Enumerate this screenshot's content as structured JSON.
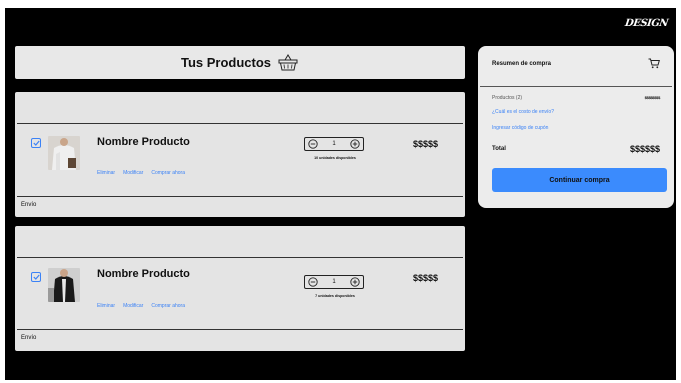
{
  "brand": {
    "logo_text": "DESIGN"
  },
  "header": {
    "title": "Tus Productos"
  },
  "products": [
    {
      "name": "Nombre Producto",
      "links": [
        "Eliminar",
        "Modificar",
        "Comprar ahora"
      ],
      "quantity": "1",
      "availability": "10 unidades disponibles",
      "price": "$$$$$",
      "shipping_label": "Envío",
      "checked": true
    },
    {
      "name": "Nombre Producto",
      "links": [
        "Eliminar",
        "Modificar",
        "Comprar ahora"
      ],
      "quantity": "1",
      "availability": "7 unidades disponibles",
      "price": "$$$$$",
      "shipping_label": "Envío",
      "checked": true
    }
  ],
  "summary": {
    "title": "Resumen de compra",
    "products_label": "Productos (2)",
    "products_value": "$$$$$$$$",
    "shipping_link": "¿Cuál es el costo de envío?",
    "coupon_link": "Ingresar código de cupón",
    "total_label": "Total",
    "total_value": "$$$$$$",
    "cta_label": "Continuar compra"
  },
  "colors": {
    "accent": "#3b8bfd",
    "link": "#3b82f6",
    "card": "#e4e4e4",
    "background": "#000000"
  },
  "icons": [
    "shopping-basket-icon",
    "cart-icon",
    "checkbox-checked-icon",
    "minus-circle-icon",
    "plus-circle-icon"
  ]
}
